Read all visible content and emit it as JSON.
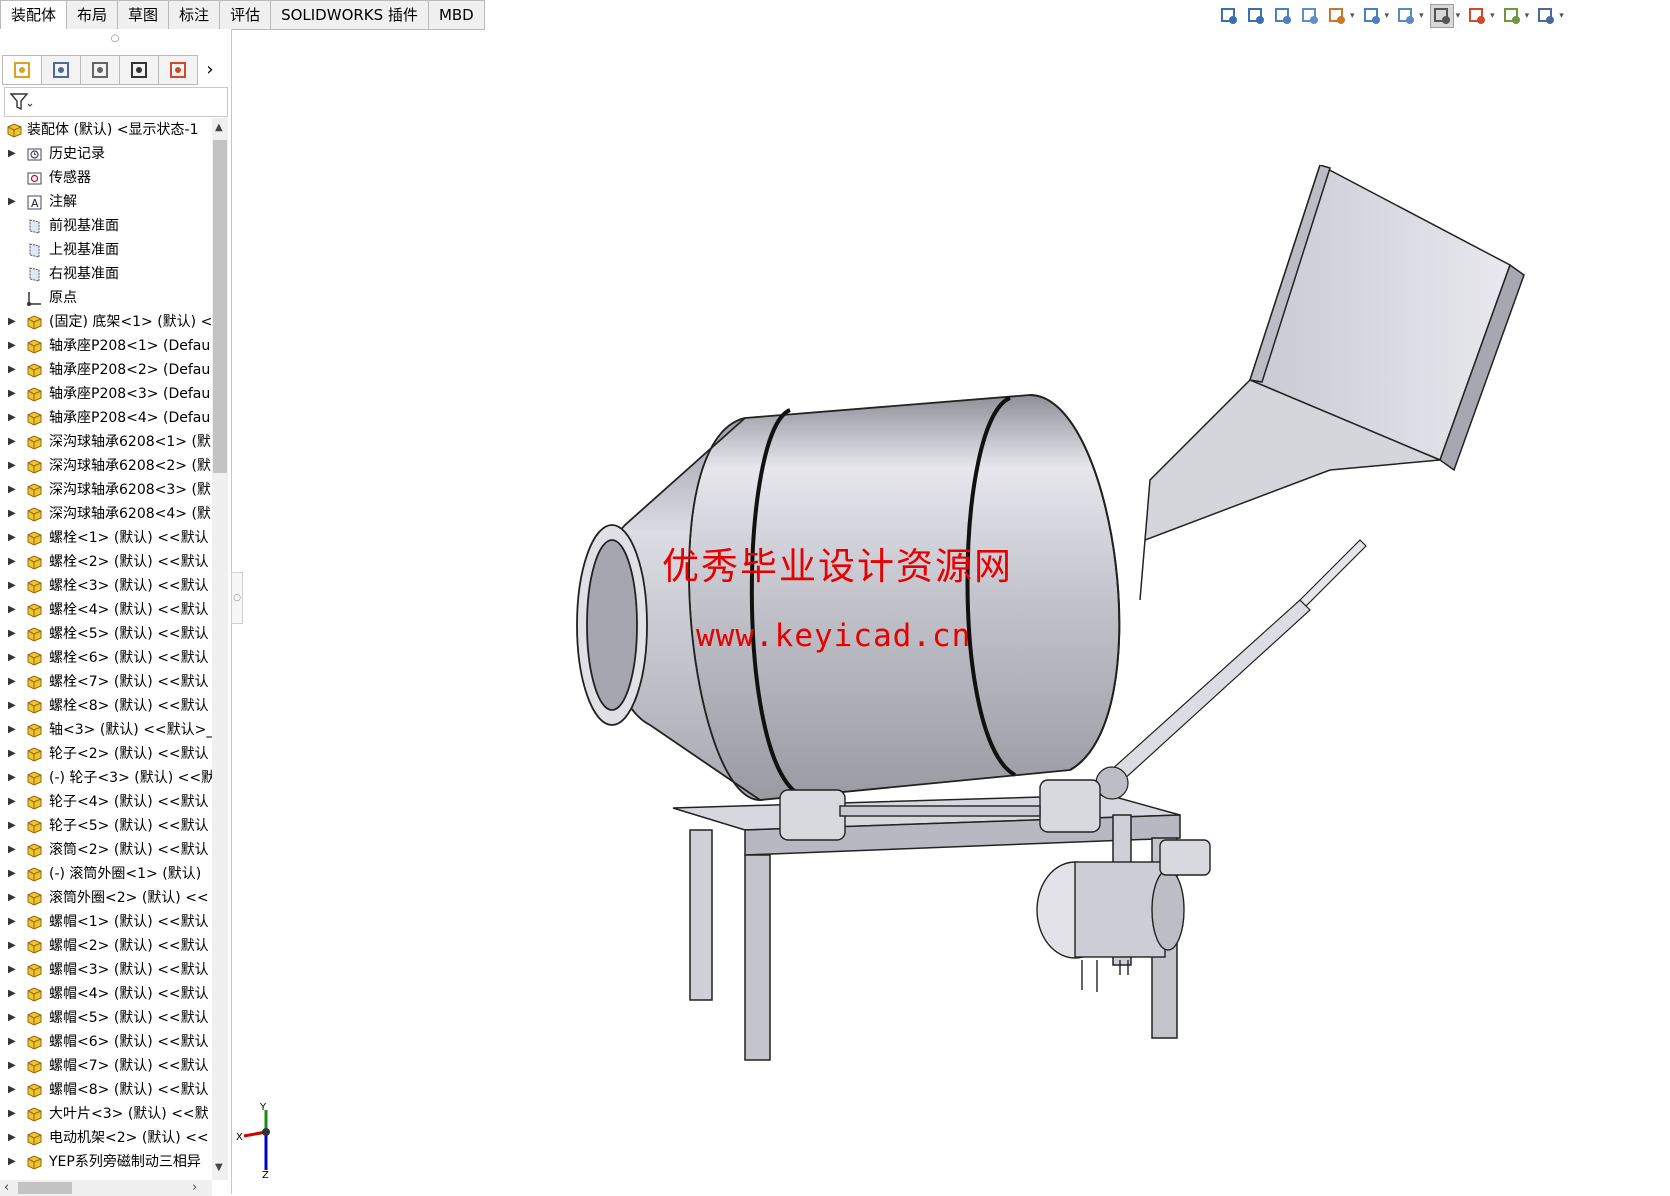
{
  "tabs": [
    "装配体",
    "布局",
    "草图",
    "标注",
    "评估",
    "SOLIDWORKS 插件",
    "MBD"
  ],
  "hud_icons": [
    "zoom-to-fit-icon",
    "zoom-to-area-icon",
    "previous-view-icon",
    "section-view-icon",
    "dynamic-annotation-icon",
    "view-orientation-icon",
    "display-style-icon",
    "hide-show-items-icon",
    "edit-appearance-icon",
    "apply-scene-icon",
    "view-settings-icon"
  ],
  "manager_tabs": [
    "featuremanager-tab",
    "propertymanager-tab",
    "configurationmanager-tab",
    "dimxpertmanager-tab",
    "displaymanager-tab"
  ],
  "tree": {
    "root": "装配体 (默认) <显示状态-1",
    "items": [
      {
        "label": "历史记录",
        "icon": "history-icon",
        "expand": true
      },
      {
        "label": "传感器",
        "icon": "sensor-icon",
        "expand": false
      },
      {
        "label": "注解",
        "icon": "annotation-icon",
        "expand": true
      },
      {
        "label": "前视基准面",
        "icon": "plane-icon",
        "expand": false
      },
      {
        "label": "上视基准面",
        "icon": "plane-icon",
        "expand": false
      },
      {
        "label": "右视基准面",
        "icon": "plane-icon",
        "expand": false
      },
      {
        "label": "原点",
        "icon": "origin-icon",
        "expand": false
      },
      {
        "label": "(固定) 底架<1> (默认) <",
        "icon": "part-icon",
        "expand": true
      },
      {
        "label": "轴承座P208<1> (Defau",
        "icon": "part-icon",
        "expand": true
      },
      {
        "label": "轴承座P208<2> (Defau",
        "icon": "part-icon",
        "expand": true
      },
      {
        "label": "轴承座P208<3> (Defau",
        "icon": "part-icon",
        "expand": true
      },
      {
        "label": "轴承座P208<4> (Defau",
        "icon": "part-icon",
        "expand": true
      },
      {
        "label": "深沟球轴承6208<1> (默",
        "icon": "part-icon",
        "expand": true
      },
      {
        "label": "深沟球轴承6208<2> (默",
        "icon": "part-icon",
        "expand": true
      },
      {
        "label": "深沟球轴承6208<3> (默",
        "icon": "part-icon",
        "expand": true
      },
      {
        "label": "深沟球轴承6208<4> (默",
        "icon": "part-icon",
        "expand": true
      },
      {
        "label": "螺栓<1> (默认) <<默认",
        "icon": "part-icon",
        "expand": true
      },
      {
        "label": "螺栓<2> (默认) <<默认",
        "icon": "part-icon",
        "expand": true
      },
      {
        "label": "螺栓<3> (默认) <<默认",
        "icon": "part-icon",
        "expand": true
      },
      {
        "label": "螺栓<4> (默认) <<默认",
        "icon": "part-icon",
        "expand": true
      },
      {
        "label": "螺栓<5> (默认) <<默认",
        "icon": "part-icon",
        "expand": true
      },
      {
        "label": "螺栓<6> (默认) <<默认",
        "icon": "part-icon",
        "expand": true
      },
      {
        "label": "螺栓<7> (默认) <<默认",
        "icon": "part-icon",
        "expand": true
      },
      {
        "label": "螺栓<8> (默认) <<默认",
        "icon": "part-icon",
        "expand": true
      },
      {
        "label": "轴<3> (默认) <<默认>_",
        "icon": "part-icon",
        "expand": true
      },
      {
        "label": "轮子<2> (默认) <<默认",
        "icon": "part-icon",
        "expand": true
      },
      {
        "label": "(-) 轮子<3> (默认) <<默",
        "icon": "part-icon",
        "expand": true
      },
      {
        "label": "轮子<4> (默认) <<默认",
        "icon": "part-icon",
        "expand": true
      },
      {
        "label": "轮子<5> (默认) <<默认",
        "icon": "part-icon",
        "expand": true
      },
      {
        "label": "滚筒<2> (默认) <<默认",
        "icon": "part-icon",
        "expand": true
      },
      {
        "label": "(-) 滚筒外圈<1> (默认)",
        "icon": "part-icon",
        "expand": true
      },
      {
        "label": "滚筒外圈<2> (默认) <<",
        "icon": "part-icon",
        "expand": true
      },
      {
        "label": "螺帽<1> (默认) <<默认",
        "icon": "part-icon",
        "expand": true
      },
      {
        "label": "螺帽<2> (默认) <<默认",
        "icon": "part-icon",
        "expand": true
      },
      {
        "label": "螺帽<3> (默认) <<默认",
        "icon": "part-icon",
        "expand": true
      },
      {
        "label": "螺帽<4> (默认) <<默认",
        "icon": "part-icon",
        "expand": true
      },
      {
        "label": "螺帽<5> (默认) <<默认",
        "icon": "part-icon",
        "expand": true
      },
      {
        "label": "螺帽<6> (默认) <<默认",
        "icon": "part-icon",
        "expand": true
      },
      {
        "label": "螺帽<7> (默认) <<默认",
        "icon": "part-icon",
        "expand": true
      },
      {
        "label": "螺帽<8> (默认) <<默认",
        "icon": "part-icon",
        "expand": true
      },
      {
        "label": "大叶片<3> (默认) <<默",
        "icon": "part-icon",
        "expand": true
      },
      {
        "label": "电动机架<2> (默认) <<",
        "icon": "part-icon",
        "expand": true
      },
      {
        "label": "YEP系列旁磁制动三相异",
        "icon": "part-icon",
        "expand": true
      }
    ]
  },
  "watermark": {
    "line1": "优秀毕业设计资源网",
    "line2": "www.keyicad.cn",
    "color": "#e60000"
  },
  "triad": {
    "x": "X",
    "y": "Y",
    "z": "Z"
  }
}
